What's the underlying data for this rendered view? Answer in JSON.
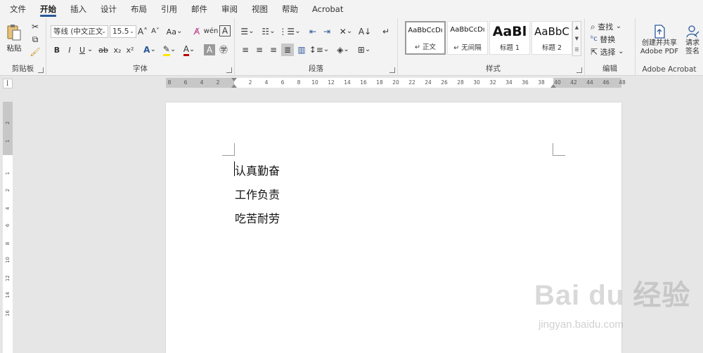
{
  "tabs": [
    "文件",
    "开始",
    "插入",
    "设计",
    "布局",
    "引用",
    "邮件",
    "审阅",
    "视图",
    "帮助",
    "Acrobat"
  ],
  "active_tab": "开始",
  "clipboard": {
    "paste_label": "粘贴",
    "group_label": "剪贴板"
  },
  "font": {
    "font_name": "等线 (中文正文",
    "font_size": "15.5",
    "change_case": "Aa",
    "format_buttons": [
      "B",
      "I",
      "U",
      "ab",
      "x₂",
      "x²"
    ],
    "group_label": "字体"
  },
  "paragraph": {
    "group_label": "段落"
  },
  "styles": {
    "cards": [
      {
        "sample": "AaBbCcDı",
        "name": "正文"
      },
      {
        "sample": "AaBbCcDı",
        "name": "无间隔"
      },
      {
        "sample": "AaBl",
        "name": "标题 1"
      },
      {
        "sample": "AaBbC",
        "name": "标题 2"
      }
    ],
    "group_label": "样式"
  },
  "editing": {
    "find": "查找",
    "replace": "替换",
    "select": "选择",
    "group_label": "编辑"
  },
  "acrobat": {
    "create_share": "创建并共享",
    "adobe_pdf": "Adobe PDF",
    "request": "请求",
    "sign": "签名",
    "group_label": "Adobe Acrobat"
  },
  "ruler": {
    "left_ticks": [
      "8",
      "6",
      "4",
      "2"
    ],
    "main_ticks": [
      "2",
      "4",
      "6",
      "8",
      "10",
      "12",
      "14",
      "16",
      "18",
      "20",
      "22",
      "24",
      "26",
      "28",
      "30",
      "32",
      "34",
      "36",
      "38"
    ],
    "right_ticks": [
      "40",
      "42",
      "44",
      "46",
      "48"
    ],
    "vertical_ticks": [
      "2",
      "1",
      "1",
      "2",
      "4",
      "6",
      "8",
      "10",
      "12",
      "14",
      "16"
    ]
  },
  "document": {
    "lines": [
      "认真勤奋",
      "工作负责",
      "吃苦耐劳"
    ]
  },
  "watermark": {
    "brand": "Bai du 经验",
    "url": "jingyan.baidu.com"
  }
}
